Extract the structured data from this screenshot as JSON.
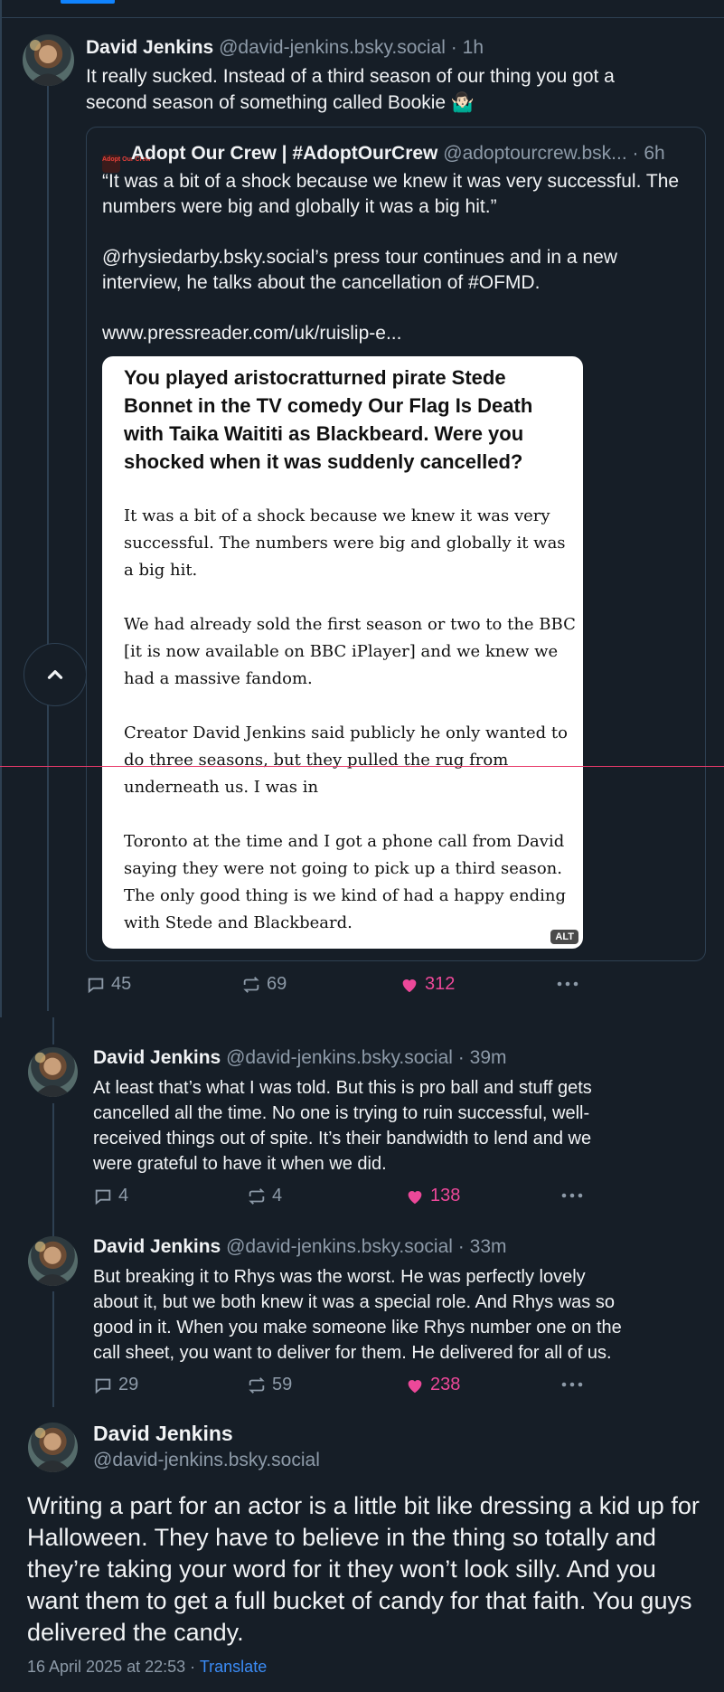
{
  "posts": [
    {
      "author_name": "David Jenkins",
      "author_handle": "@david-jenkins.bsky.social",
      "time": "1h",
      "text_lines": [
        "It really sucked. Instead of a third season of our thing you got a",
        "second season of something called Bookie 🤷🏻‍♂️"
      ],
      "quote": {
        "author_name": "Adopt Our Crew | #AdoptOurCrew",
        "author_handle": "@adoptourcrew.bsk...",
        "time": "6h",
        "avatar_text": "Adopt Our Crew",
        "paragraphs": [
          "“It was a bit of a shock because we knew it was very successful. The numbers were big and globally it was a big hit.”",
          "@rhysiedarby.bsky.social’s press tour continues and in a new interview, he talks about the cancellation of #OFMD.",
          "www.pressreader.com/uk/ruislip-e..."
        ],
        "image": {
          "question": "You played aristocratturned pirate Stede Bonnet in the TV comedy Our Flag Is Death with Taika Waititi as Blackbeard. Were you shocked when it was suddenly cancelled?",
          "answer_paragraphs": [
            "It was a bit of a shock because we knew it was very successful. The numbers were big and globally it was a big hit.",
            "We had already sold the first season or two to the BBC [it is now available on BBC iPlayer] and we knew we had a massive fandom.",
            "Creator David Jenkins said publicly he only wanted to do three seasons, but they pulled the rug from underneath us. I was in",
            "Toronto at the time and I got a phone call from David saying they were not going to pick up a third season. The only good thing is we kind of had a happy ending with Stede and Blackbeard."
          ],
          "alt_label": "ALT"
        }
      },
      "replies": "45",
      "reposts": "69",
      "likes": "312"
    },
    {
      "author_name": "David Jenkins",
      "author_handle": "@david-jenkins.bsky.social",
      "time": "39m",
      "text_lines": [
        "At least that’s what I was told. But this is pro ball and stuff gets",
        "cancelled all the time. No one is trying to ruin successful, well-",
        "received things out of spite. It’s their bandwidth to lend and we",
        "were grateful to have it when we did."
      ],
      "replies": "4",
      "reposts": "4",
      "likes": "138"
    },
    {
      "author_name": "David Jenkins",
      "author_handle": "@david-jenkins.bsky.social",
      "time": "33m",
      "text_lines": [
        "But breaking it to Rhys was the worst. He was perfectly lovely",
        "about it, but we both knew it was a special role. And Rhys was so",
        "good in it. When you make someone like Rhys number one on the",
        "call sheet, you want to deliver for them. He delivered for all of us."
      ],
      "replies": "29",
      "reposts": "59",
      "likes": "238"
    }
  ],
  "main_post": {
    "author_name": "David Jenkins",
    "author_handle": "@david-jenkins.bsky.social",
    "text": "Writing a part for an actor is a little bit like dressing a kid up for Halloween. They have to believe in the thing so totally and they’re taking your word for it they won’t look silly. And you want them to get a full bucket of candy for that faith. You guys delivered the candy.",
    "timestamp": "16 April 2025 at 22:53",
    "translate_label": "Translate"
  },
  "ui": {
    "separator_dot": "·"
  },
  "colors": {
    "background": "#161e27",
    "accent": "#1083fe",
    "like": "#ec4899",
    "muted": "#8d9aa8"
  }
}
